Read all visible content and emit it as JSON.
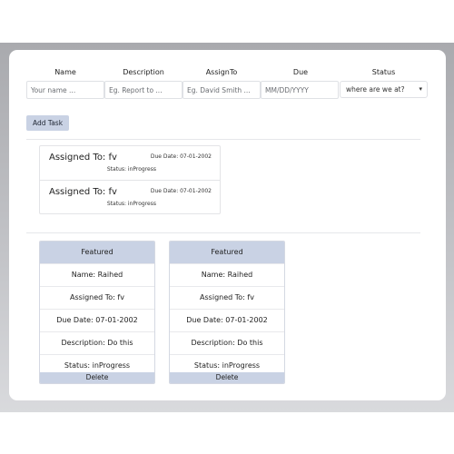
{
  "form": {
    "labels": {
      "name": "Name",
      "description": "Description",
      "assign_to": "AssignTo",
      "due": "Due",
      "status": "Status"
    },
    "placeholders": {
      "name": "Your name ...",
      "description": "Eg. Report to ...",
      "assign_to": "Eg. David Smith ...",
      "due": "MM/DD/YYYY"
    },
    "status_select": "where are we at?",
    "add_button": "Add Task"
  },
  "task_list": [
    {
      "assigned": "Assigned To: fv",
      "due": "Due Date: 07-01-2002",
      "status": "Status: inProgress"
    },
    {
      "assigned": "Assigned To: fv",
      "due": "Due Date: 07-01-2002",
      "status": "Status: inProgress"
    }
  ],
  "cards": [
    {
      "header": "Featured",
      "name": "Name: Raihed",
      "assigned": "Assigned To: fv",
      "due": "Due Date: 07-01-2002",
      "description": "Description: Do this",
      "status": "Status: inProgress",
      "delete": "Delete"
    },
    {
      "header": "Featured",
      "name": "Name: Raihed",
      "assigned": "Assigned To: fv",
      "due": "Due Date: 07-01-2002",
      "description": "Description: Do this",
      "status": "Status: inProgress",
      "delete": "Delete"
    }
  ]
}
